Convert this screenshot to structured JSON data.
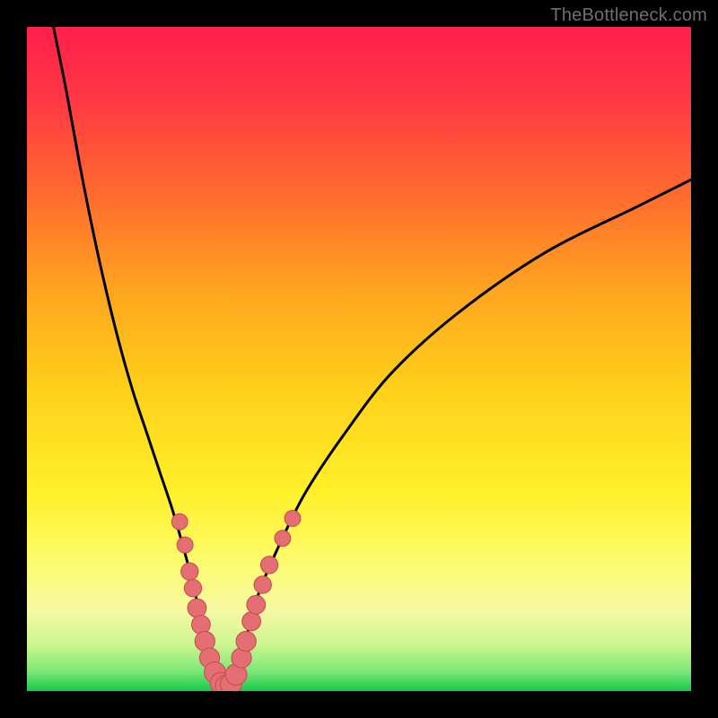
{
  "watermark": "TheBottleneck.com",
  "colors": {
    "frame": "#000000",
    "watermark": "#6f6f6f",
    "curve": "#000000",
    "dot_fill": "#e36f72",
    "dot_stroke": "#c94d52",
    "gradient_stops": [
      {
        "offset": 0.0,
        "color": "#ff1f4b"
      },
      {
        "offset": 0.1,
        "color": "#ff3545"
      },
      {
        "offset": 0.25,
        "color": "#ff6a2f"
      },
      {
        "offset": 0.4,
        "color": "#ffa61f"
      },
      {
        "offset": 0.55,
        "color": "#ffd21a"
      },
      {
        "offset": 0.7,
        "color": "#fff029"
      },
      {
        "offset": 0.8,
        "color": "#fdfb6a"
      },
      {
        "offset": 0.88,
        "color": "#f6f9a5"
      },
      {
        "offset": 0.93,
        "color": "#cdf58f"
      },
      {
        "offset": 0.97,
        "color": "#7de877"
      },
      {
        "offset": 1.0,
        "color": "#17c94a"
      }
    ]
  },
  "chart_data": {
    "type": "line",
    "title": "",
    "xlabel": "",
    "ylabel": "",
    "xlim": [
      0,
      100
    ],
    "ylim": [
      0,
      100
    ],
    "grid": false,
    "series": [
      {
        "name": "bottleneck-curve",
        "x": [
          4,
          6,
          8,
          10,
          12,
          14,
          16,
          18,
          20,
          22,
          24,
          25.5,
          27,
          28.5,
          29.5,
          30.5,
          31.5,
          33,
          35,
          38,
          42,
          48,
          55,
          65,
          78,
          92,
          100
        ],
        "y": [
          100,
          90,
          79,
          69,
          60,
          52,
          45,
          39,
          33,
          27,
          20,
          14,
          8,
          3,
          1,
          1,
          3,
          8,
          15,
          22,
          30,
          39,
          48,
          57,
          66,
          73,
          77
        ]
      }
    ],
    "scatter_points": {
      "name": "highlight-dots",
      "points": [
        {
          "x": 23.0,
          "y": 25.5,
          "r": 1.2
        },
        {
          "x": 23.8,
          "y": 22.0,
          "r": 1.2
        },
        {
          "x": 24.5,
          "y": 18.0,
          "r": 1.3
        },
        {
          "x": 25.0,
          "y": 15.5,
          "r": 1.3
        },
        {
          "x": 25.6,
          "y": 12.5,
          "r": 1.4
        },
        {
          "x": 26.2,
          "y": 10.0,
          "r": 1.4
        },
        {
          "x": 26.8,
          "y": 7.5,
          "r": 1.5
        },
        {
          "x": 27.5,
          "y": 5.0,
          "r": 1.5
        },
        {
          "x": 28.3,
          "y": 2.8,
          "r": 1.6
        },
        {
          "x": 29.2,
          "y": 1.2,
          "r": 1.6
        },
        {
          "x": 30.0,
          "y": 0.8,
          "r": 1.6
        },
        {
          "x": 30.7,
          "y": 1.0,
          "r": 1.6
        },
        {
          "x": 31.5,
          "y": 2.5,
          "r": 1.6
        },
        {
          "x": 32.3,
          "y": 5.0,
          "r": 1.5
        },
        {
          "x": 33.0,
          "y": 7.5,
          "r": 1.5
        },
        {
          "x": 33.8,
          "y": 10.5,
          "r": 1.4
        },
        {
          "x": 34.5,
          "y": 13.0,
          "r": 1.4
        },
        {
          "x": 35.5,
          "y": 16.0,
          "r": 1.3
        },
        {
          "x": 36.5,
          "y": 19.0,
          "r": 1.3
        },
        {
          "x": 38.5,
          "y": 23.0,
          "r": 1.2
        },
        {
          "x": 40.0,
          "y": 26.0,
          "r": 1.2
        }
      ]
    }
  }
}
